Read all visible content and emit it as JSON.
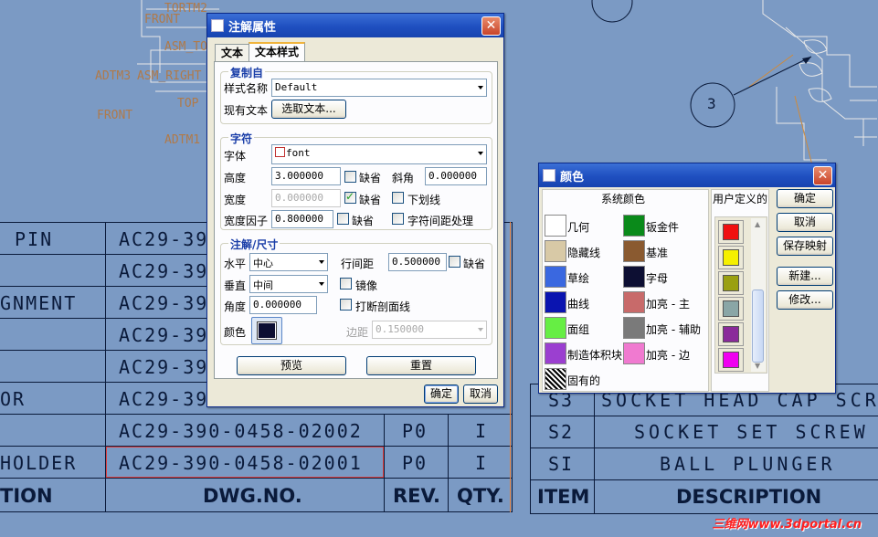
{
  "cad": {
    "bom_top_labels": [
      "PIN",
      "",
      "GNMENT",
      "",
      "",
      "OR",
      "",
      "HOLDER"
    ],
    "dwg_rows": [
      "AC29-39",
      "AC29-39",
      "AC29-39",
      "AC29-39",
      "AC29-39",
      "AC29-39",
      "AC29-390-0458-02002",
      "AC29-390-0458-02001"
    ],
    "rev_rows": [
      "P0",
      "P0"
    ],
    "qty_rows": [
      "I",
      "I"
    ],
    "header": {
      "description_partial": "TION",
      "dwg_no": "DWG.NO.",
      "rev": "REV.",
      "qty": "QTY.",
      "item": "ITEM",
      "description": "DESCRIPTION"
    },
    "right_rows": [
      {
        "item": "S3",
        "desc": "SOCKET HEAD CAP SCREW"
      },
      {
        "item": "S2",
        "desc": "SOCKET SET SCREW"
      },
      {
        "item": "SI",
        "desc": "BALL PLUNGER"
      }
    ],
    "balloon": "3",
    "datum_labels": [
      "FRONT",
      "ASM_TO",
      "ADTM3",
      "ASM_RIGHT",
      "TOP",
      "FRONT",
      "ADTM1",
      "TORTM2",
      "TMP"
    ],
    "watermark": "三维网www.3dportal.cn"
  },
  "note_dialog": {
    "title": "注解属性",
    "tabs": [
      "文本",
      "文本样式"
    ],
    "active_tab": "文本样式",
    "copy_group": {
      "title": "复制自",
      "style_name_label": "样式名称",
      "style_name_value": "Default",
      "existing_text_label": "现有文本",
      "select_text_button": "选取文本..."
    },
    "char_group": {
      "title": "字符",
      "font_label": "字体",
      "font_value": "font",
      "height_label": "高度",
      "height_value": "3.000000",
      "height_default_label": "缺省",
      "slant_label": "斜角",
      "slant_value": "0.000000",
      "thickness_label": "宽度",
      "thickness_value": "0.000000",
      "thickness_default_label": "缺省",
      "underline_label": "下划线",
      "width_factor_label": "宽度因子",
      "width_factor_value": "0.800000",
      "width_factor_default_label": "缺省",
      "kerning_label": "字符间距处理"
    },
    "note_group": {
      "title": "注解/尺寸",
      "horizontal_label": "水平",
      "horizontal_value": "中心",
      "line_spacing_label": "行间距",
      "line_spacing_value": "0.500000",
      "line_spacing_default_label": "缺省",
      "vertical_label": "垂直",
      "vertical_value": "中间",
      "mirror_label": "镜像",
      "angle_label": "角度",
      "angle_value": "0.000000",
      "break_hatch_label": "打断剖面线",
      "color_label": "颜色",
      "color_value": "#0d0f33",
      "margin_label": "边距",
      "margin_value": "0.150000"
    },
    "preview_button": "预览",
    "reset_button": "重置",
    "ok_button": "确定",
    "cancel_button": "取消"
  },
  "color_dialog": {
    "title": "颜色",
    "system_colors_label": "系统颜色",
    "user_defined_label": "用户定义的",
    "system_colors": [
      {
        "label": "几何",
        "color": "#ffffff"
      },
      {
        "label": "钣金件",
        "color": "#0a8a1a"
      },
      {
        "label": "隐藏线",
        "color": "#d8c9a6"
      },
      {
        "label": "基准",
        "color": "#8a5a30"
      },
      {
        "label": "草绘",
        "color": "#3a68e0"
      },
      {
        "label": "字母",
        "color": "#0d0f33"
      },
      {
        "label": "曲线",
        "color": "#0a14b0"
      },
      {
        "label": "加亮 - 主",
        "color": "#c86a6a"
      },
      {
        "label": "面组",
        "color": "#66ee44"
      },
      {
        "label": "加亮 - 辅助",
        "color": "#7a7a7a"
      },
      {
        "label": "制造体积块",
        "color": "#9b3fd0"
      },
      {
        "label": "加亮 - 边",
        "color": "#f07ad0"
      },
      {
        "label": "固有的",
        "color": "hatch"
      }
    ],
    "user_colors": [
      "#f01010",
      "#f5f000",
      "#9aa010",
      "#8aa6a6",
      "#8a2a9a",
      "#f000f0"
    ],
    "buttons": [
      "确定",
      "取消",
      "保存映射",
      "新建...",
      "修改..."
    ]
  }
}
